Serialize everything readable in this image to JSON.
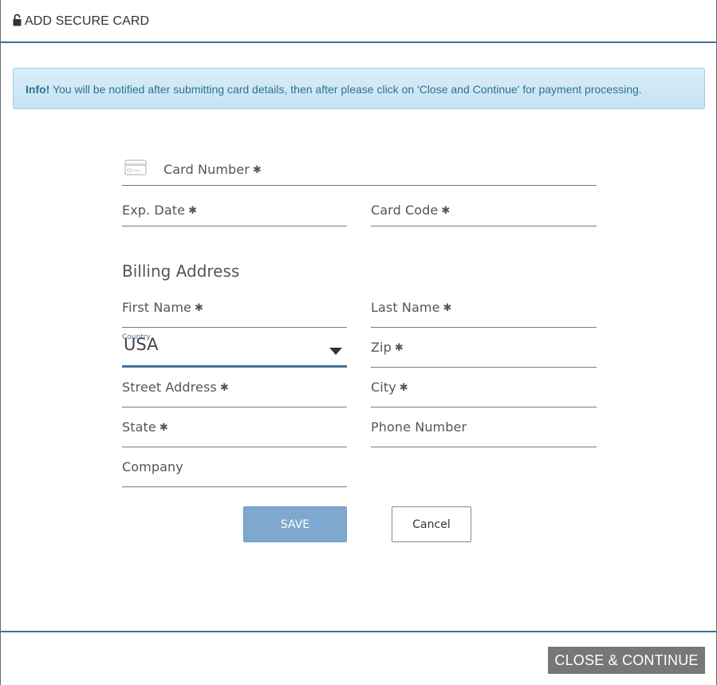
{
  "header": {
    "title": "ADD SECURE CARD",
    "icon": "lock-icon"
  },
  "info": {
    "strong": "Info!",
    "message": " You will be notified after submitting card details, then after please click on 'Close and Continue' for payment processing."
  },
  "card": {
    "icon": "credit-card-icon",
    "number_label": "Card Number",
    "exp_label": "Exp. Date",
    "code_label": "Card Code"
  },
  "billing": {
    "title": "Billing Address",
    "first_name_label": "First Name",
    "last_name_label": "Last Name",
    "country_label": "Country",
    "country_value": "USA",
    "zip_label": "Zip",
    "street_label": "Street Address",
    "city_label": "City",
    "state_label": "State",
    "phone_label": "Phone Number",
    "company_label": "Company"
  },
  "required_marker": "✱",
  "actions": {
    "save_label": "SAVE",
    "cancel_label": "Cancel"
  },
  "footer": {
    "close_continue_label": "CLOSE & CONTINUE"
  },
  "colors": {
    "accent": "#3f6f9a",
    "save_bg": "#7ea8cf",
    "info_text": "#31708f",
    "footer_button": "#777777"
  }
}
